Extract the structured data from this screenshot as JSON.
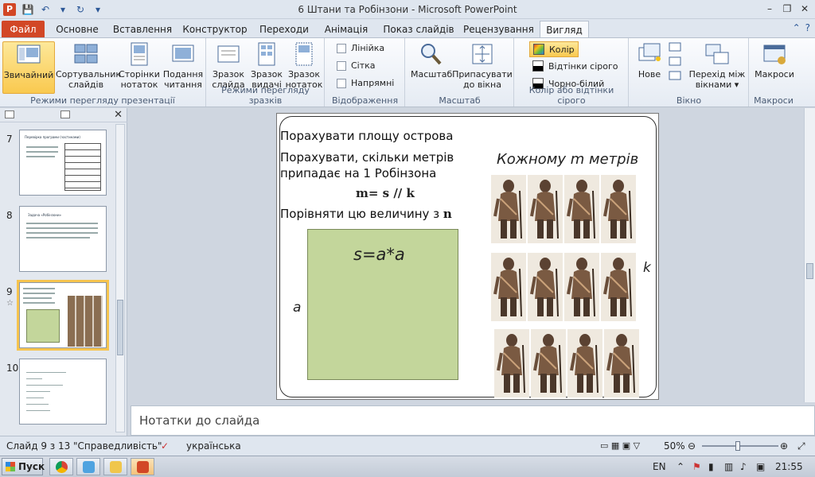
{
  "window": {
    "title": "6 Штани та Робінзони  -  Microsoft PowerPoint",
    "controls": [
      "–",
      "❐",
      "✕"
    ],
    "qat": [
      "💾",
      "↶",
      "▾",
      "↻",
      "▾"
    ]
  },
  "tabs": [
    "Файл",
    "Основне",
    "Вставлення",
    "Конструктор",
    "Переходи",
    "Анімація",
    "Показ слайдів",
    "Рецензування",
    "Вигляд"
  ],
  "active_tab": "Вигляд",
  "ribbon": {
    "presentation_views": {
      "label": "Режими перегляду презентації",
      "buttons": [
        "Звичайний",
        "Сортувальник слайдів",
        "Сторінки нотаток",
        "Подання читання"
      ]
    },
    "master_views": {
      "label": "Режими перегляду зразків",
      "buttons": [
        "Зразок слайда",
        "Зразок видачі",
        "Зразок нотаток"
      ]
    },
    "show": {
      "label": "Відображення",
      "checkboxes": [
        "Лінійка",
        "Сітка",
        "Напрямні"
      ]
    },
    "zoom": {
      "label": "Масштаб",
      "buttons": [
        "Масштаб",
        "Припасувати до вікна"
      ]
    },
    "color": {
      "label": "Колір або відтінки сірого",
      "options": [
        "Колір",
        "Відтінки сірого",
        "Чорно-білий"
      ]
    },
    "window": {
      "label": "Вікно",
      "buttons": [
        "Нове",
        "Перехід між вікнами ▾"
      ]
    },
    "macros": {
      "label": "Макроси",
      "buttons": [
        "Макроси"
      ]
    }
  },
  "thumbnails": {
    "numbers": [
      "7",
      "8",
      "9",
      "10"
    ],
    "slide7_title": "Перевірка програми (частинами)",
    "slide8_title": "Задача «Робінзони»"
  },
  "slide": {
    "line1": "Порахувати  площу острова",
    "line2": "Порахувати, скільки метрів",
    "line3": "припадає на 1 Робінзона",
    "formula": "m= s // k",
    "line4a": "Порівняти цю величину з ",
    "line4b": "n",
    "equation": "s=a*a",
    "side_a": "a",
    "each_label": "Кожному m метрів",
    "side_k": "k"
  },
  "notes_placeholder": "Нотатки до слайда",
  "status": {
    "slide_pos": "Слайд 9 з 13",
    "theme": "\"Справедливість\"",
    "language": "українська",
    "zoom": "50%",
    "zoom_level": 0.5
  },
  "taskbar": {
    "start": "Пуск",
    "lang": "EN",
    "time": "21:55"
  }
}
